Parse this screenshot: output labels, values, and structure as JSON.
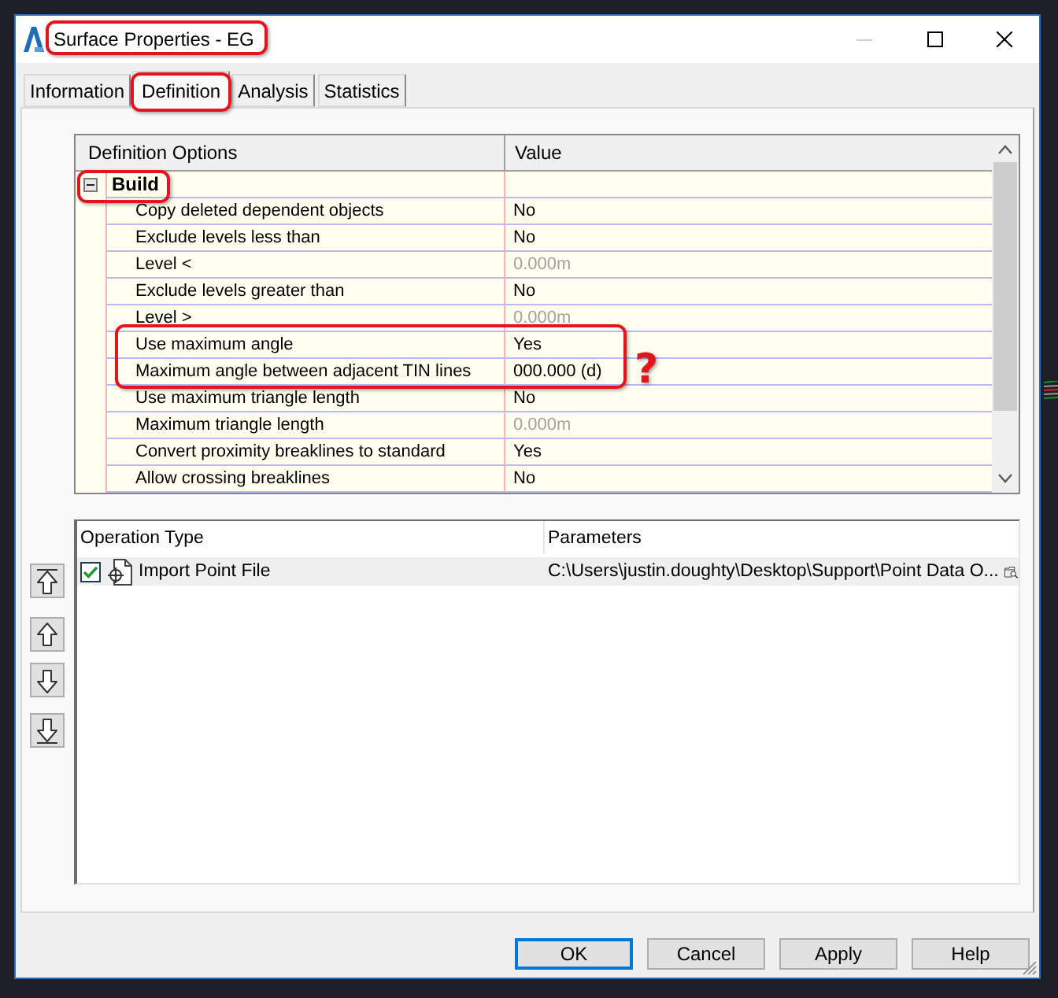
{
  "window": {
    "title": "Surface Properties - EG",
    "circled": true,
    "minimize_disabled": true
  },
  "tabs": [
    {
      "label": "Information",
      "selected": false,
      "circled": false
    },
    {
      "label": "Definition",
      "selected": true,
      "circled": true
    },
    {
      "label": "Analysis",
      "selected": false,
      "circled": false
    },
    {
      "label": "Statistics",
      "selected": false,
      "circled": false
    }
  ],
  "definition_grid": {
    "columns": [
      "Definition Options",
      "Value"
    ],
    "annotation_note": "?",
    "groups": [
      {
        "label": "Build",
        "expanded": true,
        "circled": true,
        "rows": [
          {
            "name": "Copy deleted dependent objects",
            "value": "No",
            "disabled": false,
            "circled": false
          },
          {
            "name": "Exclude levels less than",
            "value": "No",
            "disabled": false,
            "circled": false
          },
          {
            "name": "Level <",
            "value": "0.000m",
            "disabled": true,
            "circled": false
          },
          {
            "name": "Exclude levels greater than",
            "value": "No",
            "disabled": false,
            "circled": false
          },
          {
            "name": "Level >",
            "value": "0.000m",
            "disabled": true,
            "circled": false
          },
          {
            "name": "Use maximum angle",
            "value": "Yes",
            "disabled": false,
            "circled": true
          },
          {
            "name": "Maximum angle between adjacent TIN lines",
            "value": "000.000 (d)",
            "disabled": false,
            "circled": true
          },
          {
            "name": "Use maximum triangle length",
            "value": "No",
            "disabled": false,
            "circled": false
          },
          {
            "name": "Maximum triangle length",
            "value": "0.000m",
            "disabled": true,
            "circled": false
          },
          {
            "name": "Convert proximity breaklines to standard",
            "value": "Yes",
            "disabled": false,
            "circled": false
          },
          {
            "name": "Allow crossing breaklines",
            "value": "No",
            "disabled": false,
            "circled": false
          }
        ]
      }
    ]
  },
  "operations": {
    "columns": [
      "Operation Type",
      "Parameters"
    ],
    "rows": [
      {
        "type": "Import Point File",
        "parameters": "C:\\Users\\justin.doughty\\Desktop\\Support\\Point Data O...",
        "checked": true,
        "selected": true
      }
    ]
  },
  "buttons": [
    {
      "label": "OK",
      "focused": true
    },
    {
      "label": "Cancel",
      "focused": false
    },
    {
      "label": "Apply",
      "focused": false
    },
    {
      "label": "Help",
      "focused": false
    }
  ]
}
